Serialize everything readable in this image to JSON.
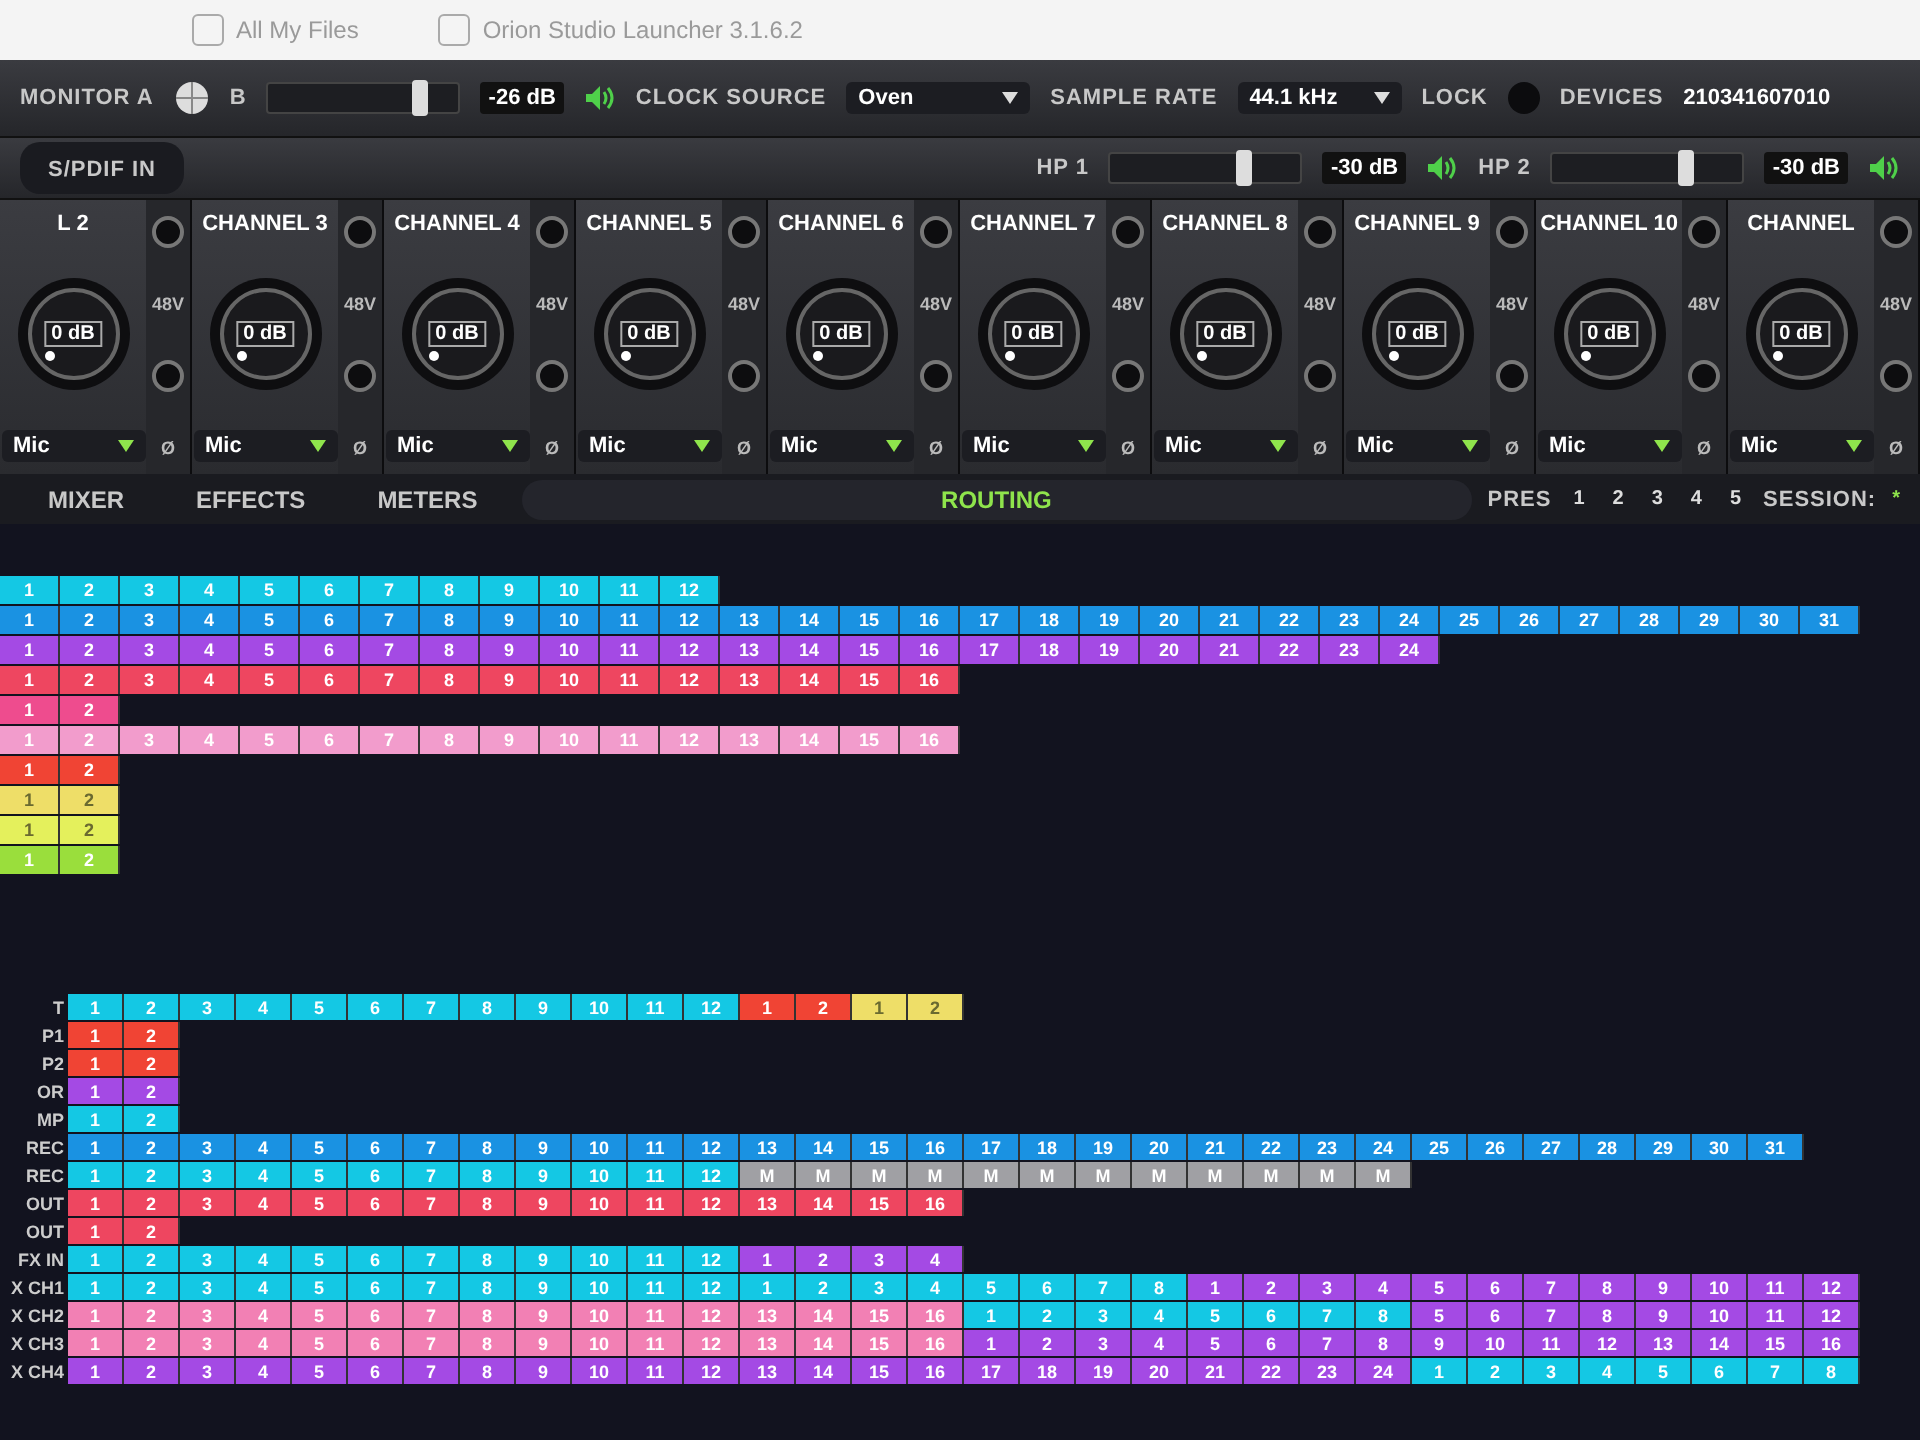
{
  "desktop": {
    "file_label": "All My Files",
    "window_title": "Orion Studio Launcher 3.1.6.2"
  },
  "toolbar": {
    "monitor_label": "MONITOR A",
    "monitor_b_label": "B",
    "monitor_slider": {
      "level": 0.8,
      "reading": "-26 dB"
    },
    "clock_label": "CLOCK SOURCE",
    "clock_value": "Oven",
    "rate_label": "SAMPLE RATE",
    "rate_value": "44.1 kHz",
    "lock_label": "LOCK",
    "devices_label": "DEVICES",
    "devices_value": "210341607010"
  },
  "toolbar2": {
    "spdif_label": "S/PDIF IN",
    "headphones": [
      {
        "label": "HP 1",
        "level": 0.7,
        "reading": "-30 dB"
      },
      {
        "label": "HP 2",
        "level": 0.7,
        "reading": "-30 dB"
      }
    ]
  },
  "channels": [
    {
      "name": "L 2",
      "gain": "0 dB",
      "input": "Mic",
      "phantom": "48V",
      "phase": "Ø"
    },
    {
      "name": "CHANNEL 3",
      "gain": "0 dB",
      "input": "Mic",
      "phantom": "48V",
      "phase": "Ø"
    },
    {
      "name": "CHANNEL 4",
      "gain": "0 dB",
      "input": "Mic",
      "phantom": "48V",
      "phase": "Ø"
    },
    {
      "name": "CHANNEL 5",
      "gain": "0 dB",
      "input": "Mic",
      "phantom": "48V",
      "phase": "Ø"
    },
    {
      "name": "CHANNEL 6",
      "gain": "0 dB",
      "input": "Mic",
      "phantom": "48V",
      "phase": "Ø"
    },
    {
      "name": "CHANNEL 7",
      "gain": "0 dB",
      "input": "Mic",
      "phantom": "48V",
      "phase": "Ø"
    },
    {
      "name": "CHANNEL 8",
      "gain": "0 dB",
      "input": "Mic",
      "phantom": "48V",
      "phase": "Ø"
    },
    {
      "name": "CHANNEL 9",
      "gain": "0 dB",
      "input": "Mic",
      "phantom": "48V",
      "phase": "Ø"
    },
    {
      "name": "CHANNEL 10",
      "gain": "0 dB",
      "input": "Mic",
      "phantom": "48V",
      "phase": "Ø"
    },
    {
      "name": "CHANNEL",
      "gain": "0 dB",
      "input": "Mic",
      "phantom": "48V",
      "phase": "Ø"
    }
  ],
  "tabs": [
    {
      "label": "MIXER",
      "selected": false
    },
    {
      "label": "EFFECTS",
      "selected": false
    },
    {
      "label": "METERS",
      "selected": false
    },
    {
      "label": "ROUTING",
      "selected": true
    }
  ],
  "presets": {
    "label": "PRES",
    "items": [
      "1",
      "2",
      "3",
      "4",
      "5"
    ],
    "session_label": "SESSION:",
    "session_mark": "*"
  },
  "matrix_top": {
    "rows": [
      {
        "segments": [
          {
            "color": "#14c8e4",
            "labels": [
              "1",
              "2",
              "3",
              "4",
              "5",
              "6",
              "7",
              "8",
              "9",
              "10",
              "11",
              "12"
            ]
          }
        ]
      },
      {
        "segments": [
          {
            "color": "#1a92e2",
            "labels": [
              "1",
              "2",
              "3",
              "4",
              "5",
              "6",
              "7",
              "8",
              "9",
              "10",
              "11",
              "12",
              "13",
              "14",
              "15",
              "16",
              "17",
              "18",
              "19",
              "20",
              "21",
              "22",
              "23",
              "24",
              "25",
              "26",
              "27",
              "28",
              "29",
              "30",
              "31"
            ]
          }
        ]
      },
      {
        "segments": [
          {
            "color": "#a44ae4",
            "labels": [
              "1",
              "2",
              "3",
              "4",
              "5",
              "6",
              "7",
              "8",
              "9",
              "10",
              "11",
              "12",
              "13",
              "14",
              "15",
              "16",
              "17",
              "18",
              "19",
              "20",
              "21",
              "22",
              "23",
              "24"
            ]
          }
        ]
      },
      {
        "segments": [
          {
            "color": "#ee4660",
            "labels": [
              "1",
              "2",
              "3",
              "4",
              "5",
              "6",
              "7",
              "8",
              "9",
              "10",
              "11",
              "12",
              "13",
              "14",
              "15",
              "16"
            ]
          }
        ]
      },
      {
        "segments": [
          {
            "color": "#ee4c8e",
            "labels": [
              "1",
              "2"
            ]
          }
        ]
      },
      {
        "segments": [
          {
            "color": "#f29ccc",
            "labels": [
              "1",
              "2",
              "3",
              "4",
              "5",
              "6",
              "7",
              "8",
              "9",
              "10",
              "11",
              "12",
              "13",
              "14",
              "15",
              "16"
            ]
          }
        ]
      },
      {
        "segments": [
          {
            "color": "#f04434",
            "labels": [
              "1",
              "2"
            ]
          }
        ]
      },
      {
        "segments": [
          {
            "color": "#eede68",
            "labels": [
              "1",
              "2"
            ]
          }
        ]
      },
      {
        "segments": [
          {
            "color": "#e4f05c",
            "labels": [
              "1",
              "2"
            ]
          }
        ]
      },
      {
        "segments": [
          {
            "color": "#9ade3c",
            "labels": [
              "1",
              "2"
            ]
          }
        ]
      }
    ]
  },
  "matrix_bottom": {
    "rows": [
      {
        "label": "T",
        "segments": [
          {
            "color": "#14c8e4",
            "labels": [
              "1",
              "2",
              "3",
              "4",
              "5",
              "6",
              "7",
              "8",
              "9",
              "10",
              "11",
              "12"
            ]
          },
          {
            "color": "#f04434",
            "labels": [
              "1",
              "2"
            ]
          },
          {
            "color": "#eede68",
            "labels": [
              "1",
              "2"
            ]
          }
        ]
      },
      {
        "label": "P1",
        "segments": [
          {
            "color": "#f04434",
            "labels": [
              "1",
              "2"
            ]
          }
        ]
      },
      {
        "label": "P2",
        "segments": [
          {
            "color": "#f04434",
            "labels": [
              "1",
              "2"
            ]
          }
        ]
      },
      {
        "label": "OR",
        "segments": [
          {
            "color": "#a44ae4",
            "labels": [
              "1",
              "2"
            ]
          }
        ]
      },
      {
        "label": "MP",
        "segments": [
          {
            "color": "#14c8e4",
            "labels": [
              "1",
              "2"
            ]
          }
        ]
      },
      {
        "label": "REC",
        "segments": [
          {
            "color": "#1a92e2",
            "labels": [
              "1",
              "2",
              "3",
              "4",
              "5",
              "6",
              "7",
              "8",
              "9",
              "10",
              "11",
              "12",
              "13",
              "14",
              "15",
              "16",
              "17",
              "18",
              "19",
              "20",
              "21",
              "22",
              "23",
              "24",
              "25",
              "26",
              "27",
              "28",
              "29",
              "30",
              "31"
            ]
          }
        ]
      },
      {
        "label": "REC",
        "segments": [
          {
            "color": "#14c8e4",
            "labels": [
              "1",
              "2",
              "3",
              "4",
              "5",
              "6",
              "7",
              "8",
              "9",
              "10",
              "11",
              "12"
            ]
          },
          {
            "color": "#a0a0a4",
            "labels": [
              "M",
              "M",
              "M",
              "M",
              "M",
              "M",
              "M",
              "M",
              "M",
              "M",
              "M",
              "M"
            ]
          }
        ]
      },
      {
        "label": "OUT",
        "segments": [
          {
            "color": "#ee4660",
            "labels": [
              "1",
              "2",
              "3",
              "4",
              "5",
              "6",
              "7",
              "8",
              "9",
              "10",
              "11",
              "12",
              "13",
              "14",
              "15",
              "16"
            ]
          }
        ]
      },
      {
        "label": "OUT",
        "segments": [
          {
            "color": "#ee4660",
            "labels": [
              "1",
              "2"
            ]
          }
        ]
      },
      {
        "label": "FX IN",
        "segments": [
          {
            "color": "#14c8e4",
            "labels": [
              "1",
              "2",
              "3",
              "4",
              "5",
              "6",
              "7",
              "8",
              "9",
              "10",
              "11",
              "12"
            ]
          },
          {
            "color": "#a44ae4",
            "labels": [
              "1",
              "2",
              "3",
              "4"
            ]
          }
        ]
      },
      {
        "label": "X CH1",
        "segments": [
          {
            "color": "#14c8e4",
            "labels": [
              "1",
              "2",
              "3",
              "4",
              "5",
              "6",
              "7",
              "8",
              "9",
              "10",
              "11",
              "12"
            ]
          },
          {
            "color": "#14c8e4",
            "labels": [
              "1",
              "2",
              "3",
              "4",
              "5",
              "6",
              "7",
              "8"
            ]
          },
          {
            "color": "#a44ae4",
            "labels": [
              "1",
              "2",
              "3",
              "4",
              "5",
              "6",
              "7",
              "8",
              "9",
              "10",
              "11",
              "12"
            ]
          }
        ]
      },
      {
        "label": "X CH2",
        "segments": [
          {
            "color": "#f280b4",
            "labels": [
              "1",
              "2",
              "3",
              "4",
              "5",
              "6",
              "7",
              "8",
              "9",
              "10",
              "11",
              "12",
              "13",
              "14",
              "15",
              "16"
            ]
          },
          {
            "color": "#14c8e4",
            "labels": [
              "1",
              "2",
              "3",
              "4",
              "5",
              "6",
              "7",
              "8"
            ]
          },
          {
            "color": "#a44ae4",
            "labels": [
              "5",
              "6",
              "7",
              "8",
              "9",
              "10",
              "11",
              "12"
            ]
          }
        ]
      },
      {
        "label": "X CH3",
        "segments": [
          {
            "color": "#f280b4",
            "labels": [
              "1",
              "2",
              "3",
              "4",
              "5",
              "6",
              "7",
              "8",
              "9",
              "10",
              "11",
              "12",
              "13",
              "14",
              "15",
              "16"
            ]
          },
          {
            "color": "#a44ae4",
            "labels": [
              "1",
              "2",
              "3",
              "4",
              "5",
              "6",
              "7",
              "8",
              "9",
              "10",
              "11",
              "12",
              "13",
              "14",
              "15",
              "16"
            ]
          }
        ]
      },
      {
        "label": "X CH4",
        "segments": [
          {
            "color": "#a44ae4",
            "labels": [
              "1",
              "2",
              "3",
              "4",
              "5",
              "6",
              "7",
              "8",
              "9",
              "10",
              "11",
              "12",
              "13",
              "14",
              "15",
              "16",
              "17",
              "18",
              "19",
              "20",
              "21",
              "22",
              "23",
              "24"
            ]
          },
          {
            "color": "#14c8e4",
            "labels": [
              "1",
              "2",
              "3",
              "4",
              "5",
              "6",
              "7",
              "8"
            ]
          }
        ]
      }
    ]
  }
}
